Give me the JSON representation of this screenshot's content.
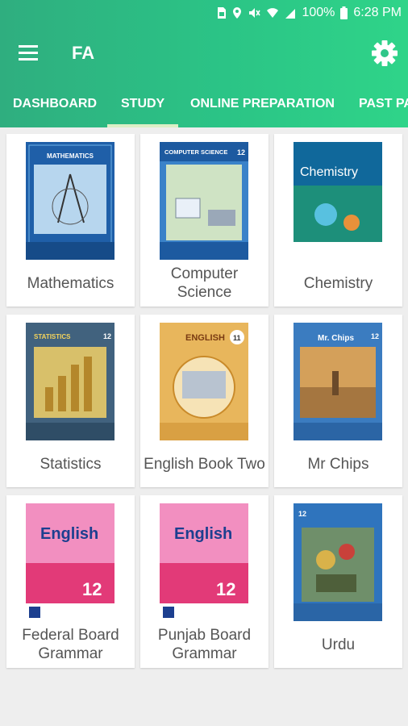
{
  "status_bar": {
    "battery_percent": "100%",
    "time": "6:28 PM"
  },
  "toolbar": {
    "title": "FA"
  },
  "tabs": [
    {
      "label": "DASHBOARD",
      "selected": false
    },
    {
      "label": "STUDY",
      "selected": true
    },
    {
      "label": "ONLINE PREPARATION",
      "selected": false
    },
    {
      "label": "PAST PA",
      "selected": false
    }
  ],
  "books": [
    {
      "label": "Mathematics",
      "cover_text": "MATHEMATICS",
      "grade": "12"
    },
    {
      "label": "Computer Science",
      "cover_text": "COMPUTER SCIENCE",
      "grade": "12"
    },
    {
      "label": "Chemistry",
      "cover_text": "Chemistry",
      "grade": ""
    },
    {
      "label": "Statistics",
      "cover_text": "STATISTICS",
      "grade": "12"
    },
    {
      "label": "English Book Two",
      "cover_text": "ENGLISH",
      "grade": "11"
    },
    {
      "label": "Mr Chips",
      "cover_text": "Mr. Chips",
      "grade": "12"
    },
    {
      "label": "Federal Board Grammar",
      "cover_text": "English",
      "grade": "12"
    },
    {
      "label": "Punjab Board Grammar",
      "cover_text": "English",
      "grade": "12"
    },
    {
      "label": "Urdu",
      "cover_text": "",
      "grade": "12"
    }
  ],
  "colors": {
    "appbar": "#2bc486",
    "indicator": "#dcefc6",
    "background": "#eeeeee"
  }
}
